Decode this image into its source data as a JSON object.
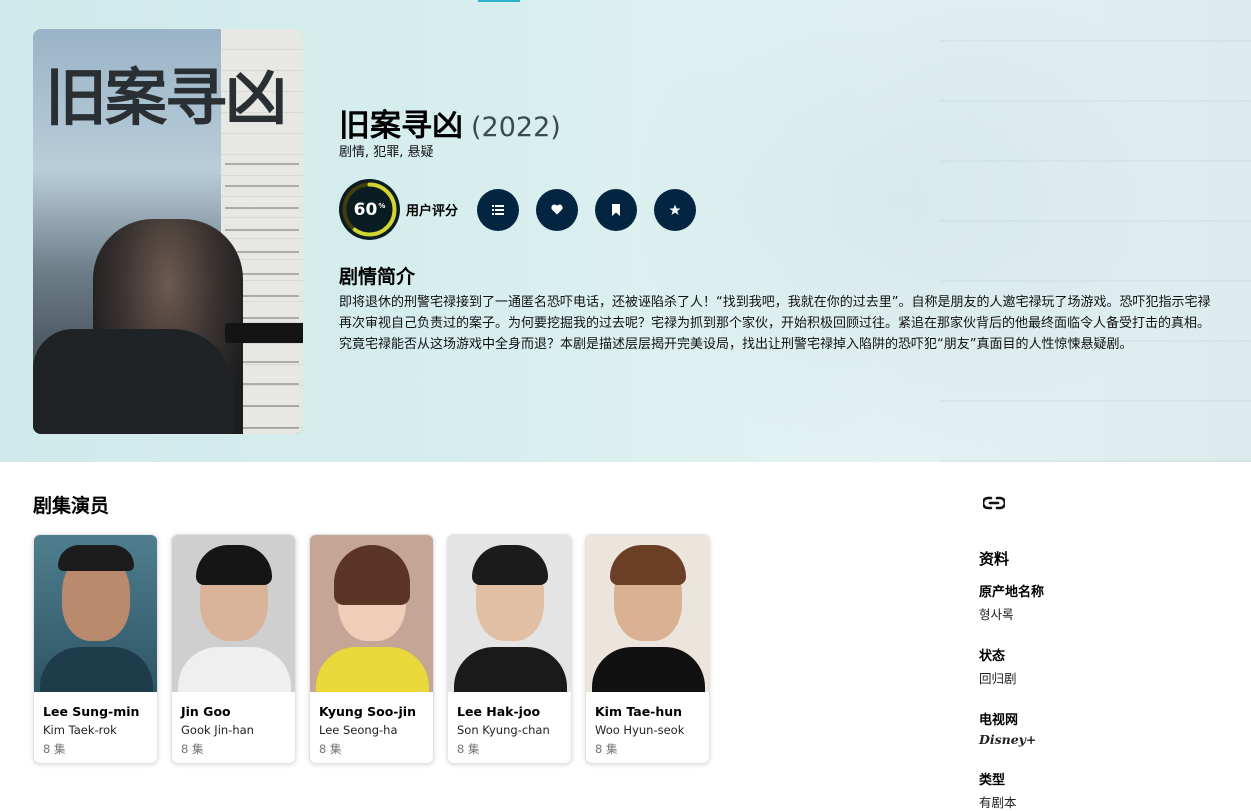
{
  "show": {
    "title": "旧案寻凶",
    "year": "(2022)",
    "genres": "剧情, 犯罪, 悬疑",
    "poster_title": "旧案寻凶",
    "score": "60",
    "score_unit": "%",
    "score_fraction": 0.6,
    "score_label": "用户评分",
    "overview_heading": "剧情简介",
    "overview": "即将退休的刑警宅禄接到了一通匿名恐吓电话，还被诬陷杀了人！“找到我吧，我就在你的过去里”。自称是朋友的人邀宅禄玩了场游戏。恐吓犯指示宅禄再次审视自己负责过的案子。为何要挖掘我的过去呢？宅禄为抓到那个家伙，开始积极回顾过往。紧追在那家伙背后的他最终面临令人备受打击的真相。究竟宅禄能否从这场游戏中全身而退？本剧是描述层层揭开完美设局，找出让刑警宅禄掉入陷阱的恐吓犯“朋友”真面目的人性惊悚悬疑剧。"
  },
  "actions": {
    "list_icon": "list-icon",
    "favorite_icon": "heart-icon",
    "watchlist_icon": "bookmark-icon",
    "rate_icon": "star-icon"
  },
  "colors": {
    "action_bg": "#032541",
    "score_ring": "#d2d531",
    "score_bg": "#081c22",
    "accent": "#2fb5c9"
  },
  "cast_heading": "剧集演员",
  "cast": [
    {
      "name": "Lee Sung-min",
      "role": "Kim Taek-rok",
      "eps": "8 集"
    },
    {
      "name": "Jin Goo",
      "role": "Gook Jin-han",
      "eps": "8 集"
    },
    {
      "name": "Kyung Soo-jin",
      "role": "Lee Seong-ha",
      "eps": "8 集"
    },
    {
      "name": "Lee Hak-joo",
      "role": "Son Kyung-chan",
      "eps": "8 集"
    },
    {
      "name": "Kim Tae-hun",
      "role": "Woo Hyun-seok",
      "eps": "8 集"
    }
  ],
  "side": {
    "link_icon": "link-icon",
    "facts_heading": "资料",
    "facts": [
      {
        "key": "原产地名称",
        "value": "형사록"
      },
      {
        "key": "状态",
        "value": "回归剧"
      },
      {
        "key": "电视网",
        "value": "Disney+"
      },
      {
        "key": "类型",
        "value": "有剧本"
      }
    ]
  }
}
